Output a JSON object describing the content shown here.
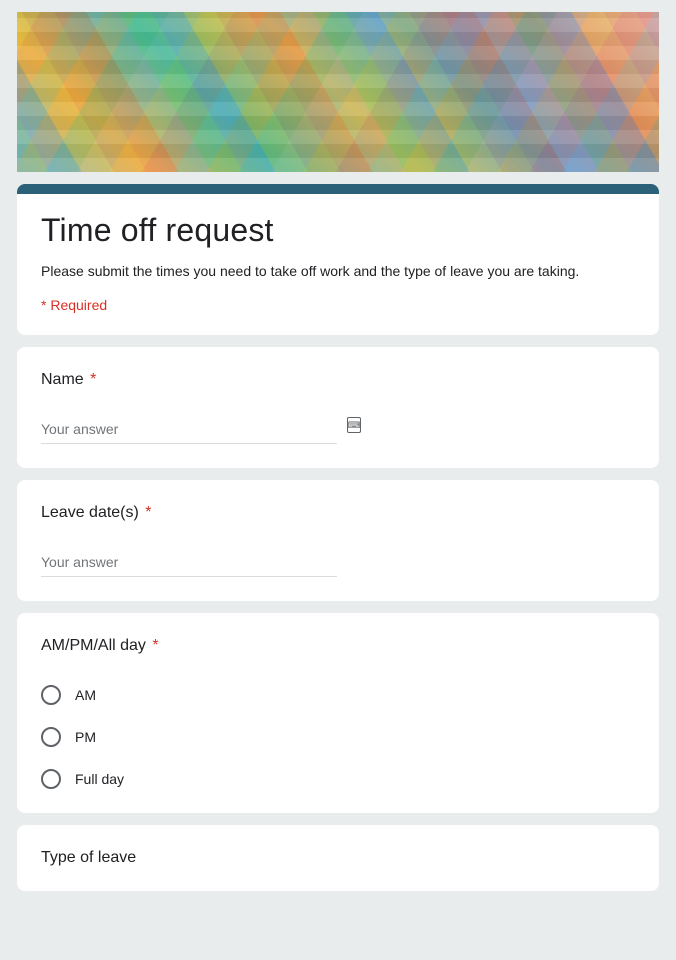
{
  "header": {
    "title": "Time off request",
    "description": "Please submit the times you need to take off work and the type of leave you are taking.",
    "required_note": "* Required"
  },
  "common": {
    "placeholder": "Your answer",
    "required_star": "*"
  },
  "questions": {
    "name": {
      "label": "Name"
    },
    "leave_dates": {
      "label": "Leave date(s)"
    },
    "ampm": {
      "label": "AM/PM/All day",
      "options": [
        "AM",
        "PM",
        "Full day"
      ]
    },
    "type_of_leave": {
      "label": "Type of leave"
    }
  }
}
